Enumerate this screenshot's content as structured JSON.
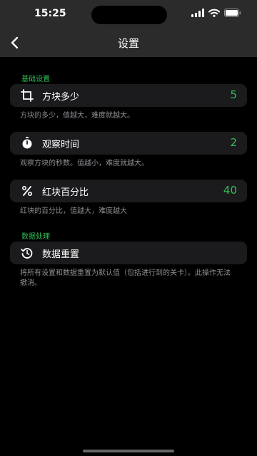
{
  "status": {
    "time": "15:25"
  },
  "nav": {
    "title": "设置"
  },
  "sections": {
    "basic": {
      "title": "基础设置"
    },
    "data": {
      "title": "数据处理"
    }
  },
  "settings": [
    {
      "icon": "crop-icon",
      "label": "方块多少",
      "value": "5",
      "hint": "方块的多少，值越大，难度就越大。"
    },
    {
      "icon": "stopwatch-icon",
      "label": "观察时间",
      "value": "2",
      "hint": "观察方块的秒数。值越小，难度就越大。"
    },
    {
      "icon": "percent-icon",
      "label": "红块百分比",
      "value": "40",
      "hint": "红块的百分比，值越大，难度越大"
    }
  ],
  "reset": {
    "icon": "history-icon",
    "label": "数据重置",
    "hint": "将所有设置和数据重置为默认值（包括进行到的关卡）。此操作无法撤消。"
  },
  "colors": {
    "accent": "#30c057",
    "card": "#1b1b1d",
    "bar": "#2b2b2b"
  }
}
